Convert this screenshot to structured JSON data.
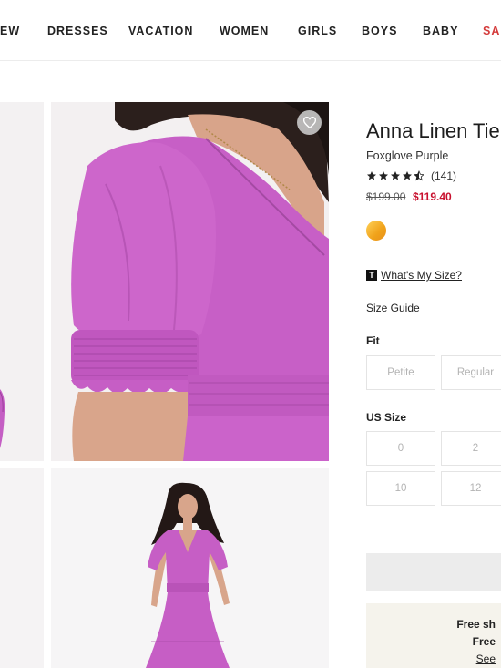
{
  "nav": {
    "items": [
      "EW",
      "DRESSES",
      "VACATION",
      "WOMEN",
      "GIRLS",
      "BOYS",
      "BABY",
      "SAL"
    ],
    "sale_color": "#d43b3b"
  },
  "product": {
    "title": "Anna Linen Tier",
    "color_name": "Foxglove Purple",
    "rating": 4.5,
    "review_count": "(141)",
    "price_original": "$199.00",
    "price_sale": "$119.40",
    "swatch_color": "#f4ad2a",
    "dress_color": "#c45ec4"
  },
  "links": {
    "whats_my_size": "What's My Size?",
    "whats_my_size_logo": "T",
    "size_guide": "Size Guide"
  },
  "fit": {
    "label": "Fit",
    "options": [
      "Petite",
      "Regular"
    ]
  },
  "us_size": {
    "label": "US Size",
    "row1": [
      "0",
      "2"
    ],
    "row2": [
      "10",
      "12"
    ]
  },
  "shipping": {
    "line1": "Free sh",
    "line2": "Free",
    "line3": "See"
  }
}
